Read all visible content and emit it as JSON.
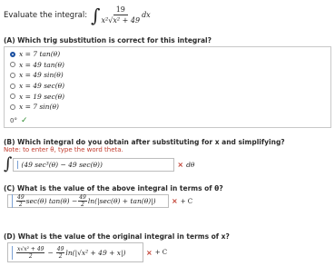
{
  "question": {
    "prompt": "Evaluate the integral:",
    "integrand_numerator": "19",
    "integrand_denominator": "x²√x² + 49",
    "differential": "dx"
  },
  "part_a": {
    "label": "(A) Which trig substitution is correct for this integral?",
    "options": [
      {
        "text": "x = 7 tan(θ)",
        "selected": true
      },
      {
        "text": "x = 49 tan(θ)",
        "selected": false
      },
      {
        "text": "x = 49 sin(θ)",
        "selected": false
      },
      {
        "text": "x = 49 sec(θ)",
        "selected": false
      },
      {
        "text": "x = 19 sec(θ)",
        "selected": false
      },
      {
        "text": "x = 7 sin(θ)",
        "selected": false
      }
    ],
    "feedback_icon": "partial-credit-icon",
    "check_icon": "check-icon"
  },
  "part_b": {
    "label": "(B) Which integral do you obtain after substituting for x and simplifying?",
    "note": "Note: to enter θ, type the word theta.",
    "answer": "(49 sec³(θ) − 49 sec(θ))",
    "differential": "dθ",
    "status_color": "#c0392b"
  },
  "part_c": {
    "label": "(C) What is the value of the above integral in terms of θ?",
    "answer_frac_num": "49",
    "answer_frac_den": "2",
    "answer_mid": "sec(θ) tan(θ) −",
    "answer_tail": "ln(|sec(θ) + tan(θ)|)",
    "constant": "+ C"
  },
  "part_d": {
    "label": "(D) What is the value of the original integral in terms of x?",
    "answer_first": "x√x² + 49",
    "answer_first_den": "2",
    "answer_frac_num": "49",
    "answer_frac_den": "2",
    "answer_tail": "ln(|√x² + 49 + x|)",
    "constant": "+ C"
  }
}
